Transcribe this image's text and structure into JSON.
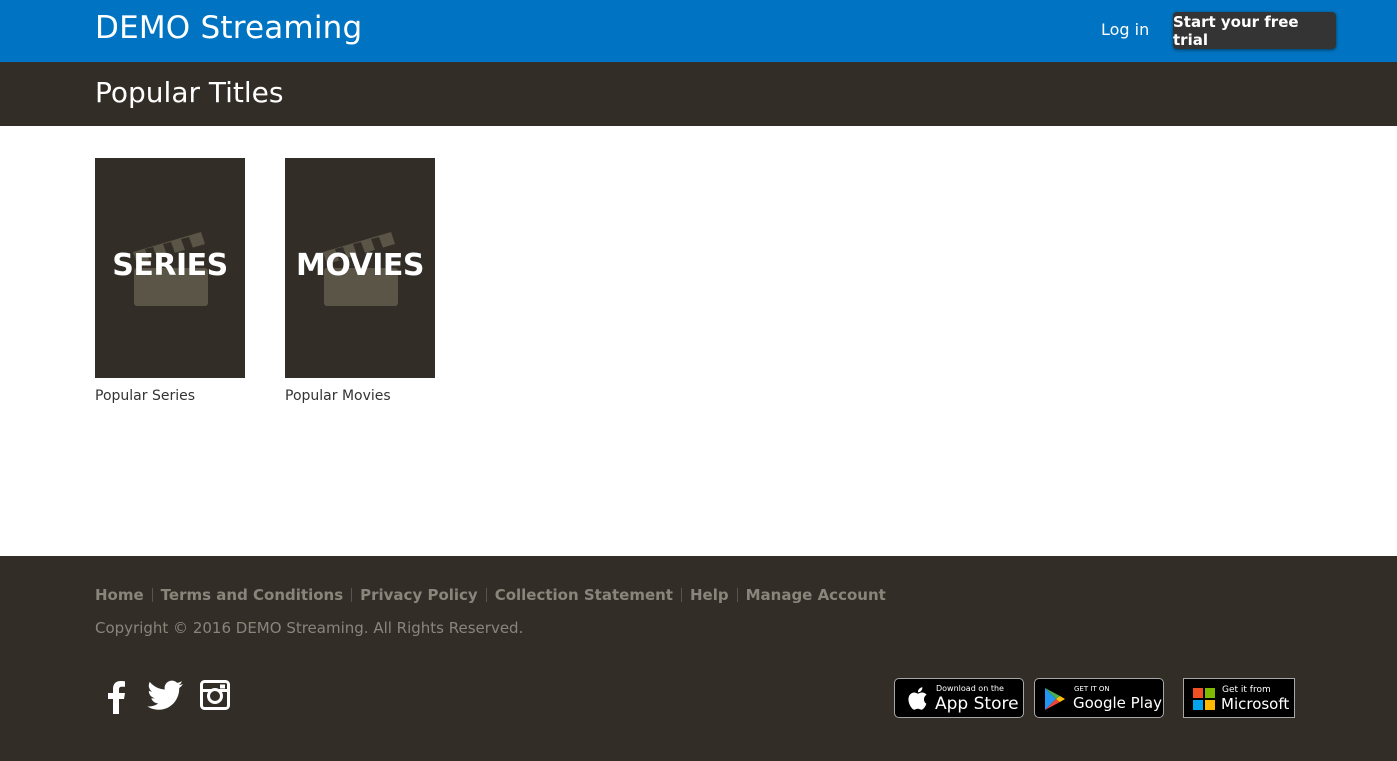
{
  "header": {
    "brand": "DEMO Streaming",
    "login_label": "Log in",
    "trial_label": "Start your free trial",
    "colors": {
      "accent": "#0074c2",
      "button": "#343434"
    }
  },
  "title_bar": {
    "title": "Popular Titles",
    "color": "#322e27"
  },
  "tiles": [
    {
      "poster_text": "SERIES",
      "caption": "Popular Series",
      "icon": "clapperboard-icon"
    },
    {
      "poster_text": "MOVIES",
      "caption": "Popular Movies",
      "icon": "clapperboard-icon"
    }
  ],
  "footer": {
    "links": [
      "Home",
      "Terms and Conditions",
      "Privacy Policy",
      "Collection Statement",
      "Help",
      "Manage Account"
    ],
    "copyright": "Copyright © 2016 DEMO Streaming. All Rights Reserved.",
    "social": [
      "facebook-icon",
      "twitter-icon",
      "instagram-icon"
    ],
    "stores": {
      "app_store": {
        "small": "Download on the",
        "big": "App Store"
      },
      "google_play": {
        "small": "GET IT ON",
        "big": "Google Play"
      },
      "microsoft": {
        "small": "Get it from",
        "big": "Microsoft"
      }
    }
  }
}
